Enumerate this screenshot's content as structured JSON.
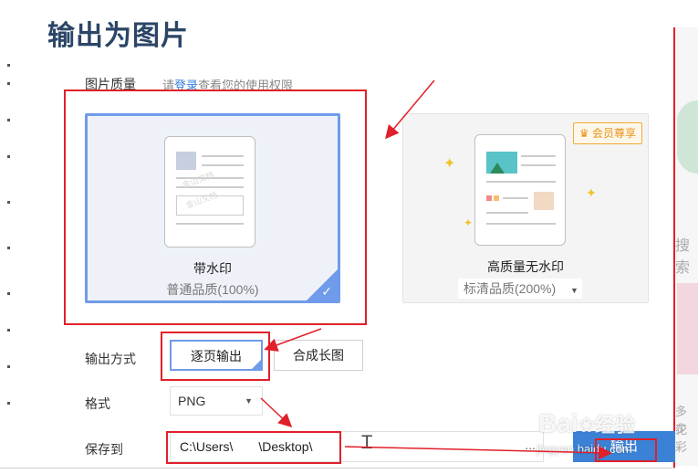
{
  "dialog": {
    "title": "输出为图片"
  },
  "quality": {
    "label": "图片质量",
    "hint_pre": "请",
    "hint_link": "登录",
    "hint_post": "查看您的使用权限",
    "options": [
      {
        "title": "带水印",
        "subtitle": "普通品质(100%)",
        "watermark": "金山文档"
      },
      {
        "title": "高质量无水印",
        "subtitle": "标清品质(200%)",
        "badge": "会员尊享"
      }
    ]
  },
  "output_mode": {
    "label": "输出方式",
    "options": [
      "逐页输出",
      "合成长图"
    ],
    "selected": "逐页输出"
  },
  "format": {
    "label": "格式",
    "value": "PNG"
  },
  "save_to": {
    "label": "保存到",
    "path": "C:\\Users\\  \\Desktop\\",
    "more": "..."
  },
  "export_button": {
    "label": "输出"
  },
  "side_fragments": {
    "a": "搜索",
    "b": "多少",
    "c": "花彩"
  },
  "watermark_text": {
    "brand": "Bai",
    "brand2": "经验",
    "url": "jingyan.baidu.com"
  },
  "colors": {
    "accent": "#6f9bea",
    "annotation": "#e0202a",
    "badge": "#e8911a",
    "primary": "#3b82d6"
  }
}
